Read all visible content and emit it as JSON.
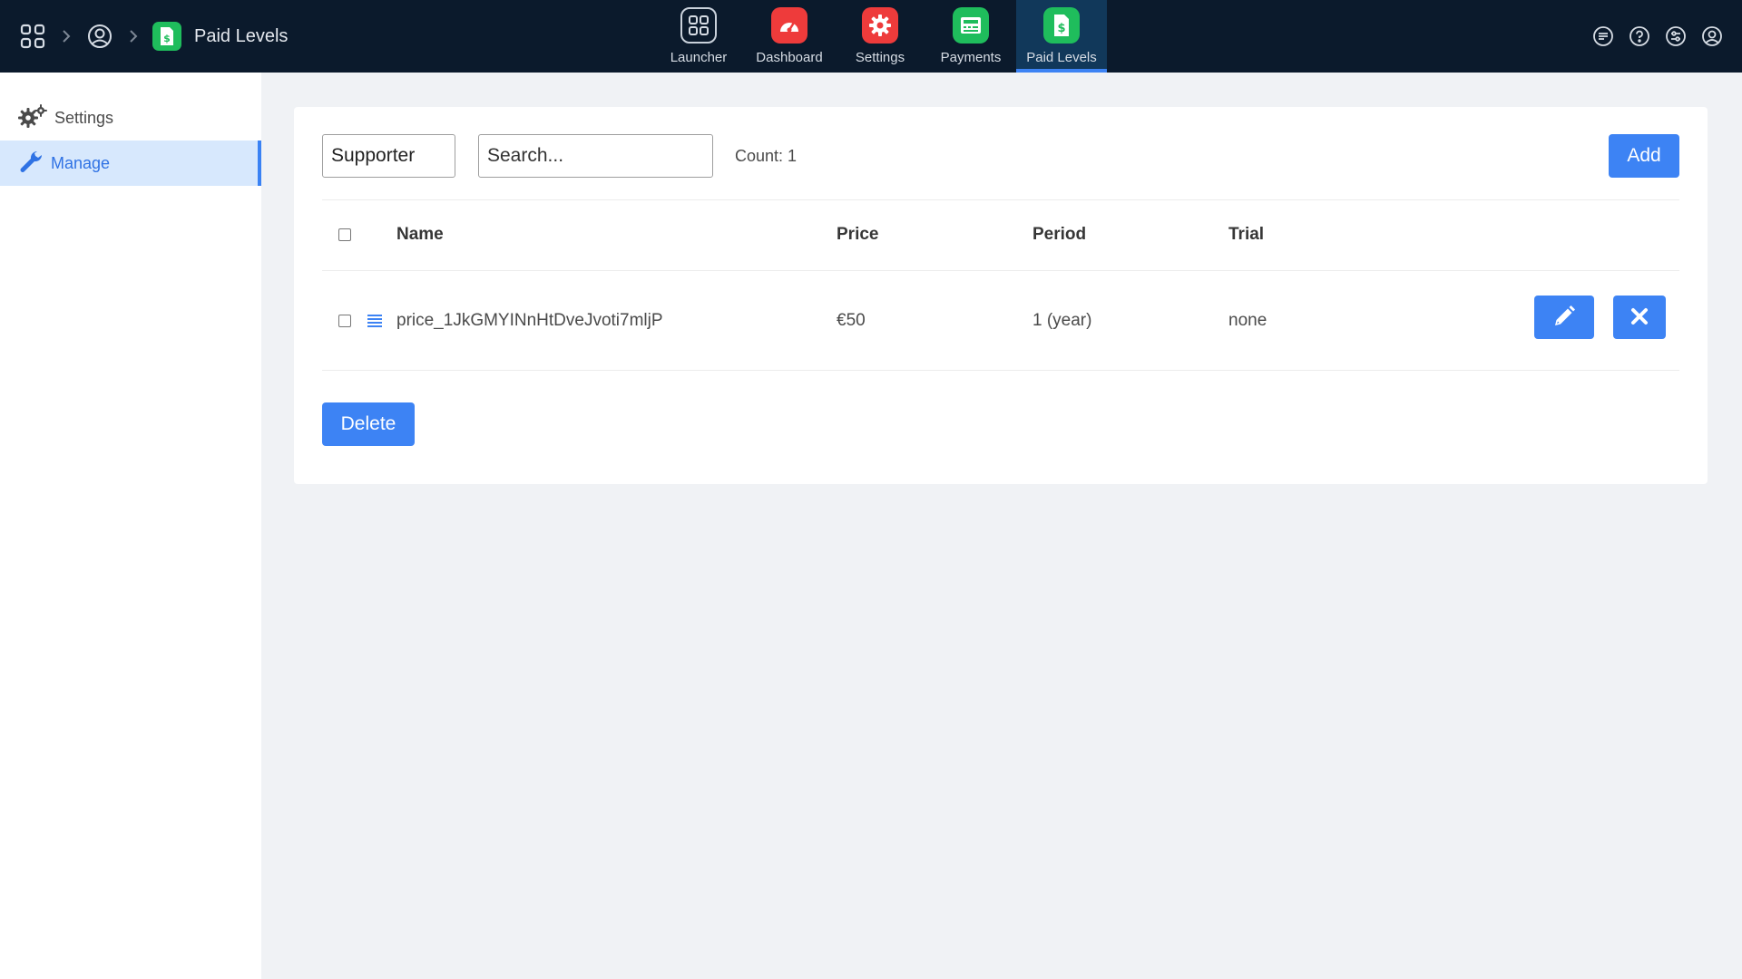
{
  "breadcrumb": {
    "home_icon": "grid-icon",
    "account_icon": "user-circle-icon",
    "app_icon": "dollar-document-icon",
    "title": "Paid Levels"
  },
  "apps": [
    {
      "label": "Launcher",
      "icon": "grid-icon",
      "color": "#1a2a3d"
    },
    {
      "label": "Dashboard",
      "icon": "gauge-icon",
      "color": "#ee3b3b"
    },
    {
      "label": "Settings",
      "icon": "gear-icon",
      "color": "#ee3b3b"
    },
    {
      "label": "Payments",
      "icon": "cash-register-icon",
      "color": "#1fbd5c"
    },
    {
      "label": "Paid Levels",
      "icon": "dollar-document-icon",
      "color": "#1fbd5c"
    }
  ],
  "active_app": "Paid Levels",
  "header_icons": [
    "chat-icon",
    "help-icon",
    "settings-sliders-icon",
    "user-circle-icon"
  ],
  "sidebar": {
    "items": [
      {
        "label": "Settings",
        "icon": "gears-icon"
      },
      {
        "label": "Manage",
        "icon": "wrench-icon"
      }
    ],
    "active": "Manage"
  },
  "toolbar": {
    "filter_value": "Supporter",
    "search_placeholder": "Search...",
    "count_label": "Count: 1",
    "add_label": "Add"
  },
  "table": {
    "columns": [
      "Name",
      "Price",
      "Period",
      "Trial"
    ],
    "rows": [
      {
        "name": "price_1JkGMYINnHtDveJvoti7mljP",
        "price": "€50",
        "period": "1 (year)",
        "trial": "none"
      }
    ]
  },
  "footer": {
    "delete_label": "Delete"
  },
  "colors": {
    "accent": "#3d83f4",
    "topbar": "#0b1a2c",
    "green": "#1fbd5c",
    "red": "#ee3b3b"
  }
}
